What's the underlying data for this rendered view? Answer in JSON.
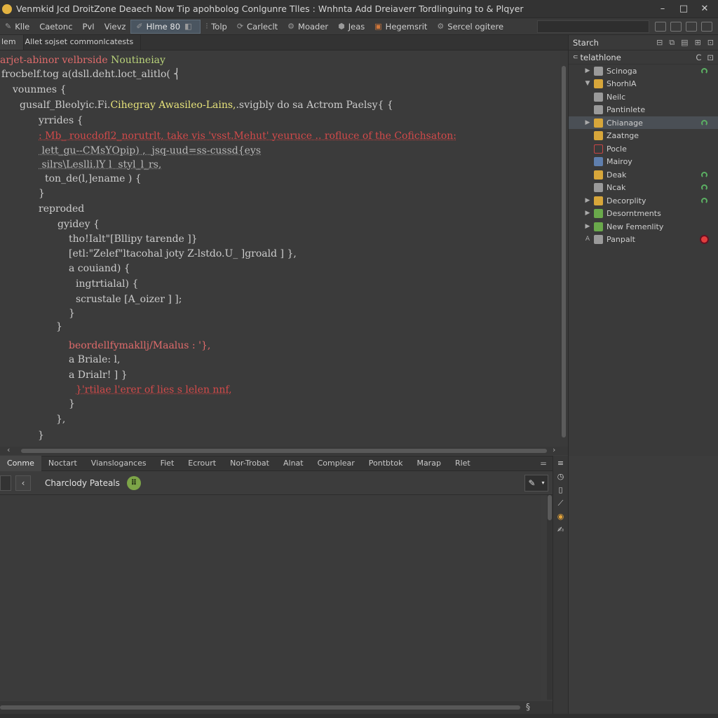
{
  "window": {
    "title": "Venmkid Jcd  DroitZone Deaech Now Tip apohbolog Conlgunre Tlles : Wnhnta Add Dreiaverr Tordlinguing to & Plqyer",
    "minimize": "–",
    "maximize": "□",
    "close": "✕"
  },
  "toolbar": {
    "items": [
      {
        "label": "Klle"
      },
      {
        "label": "Caetonc"
      },
      {
        "label": "PvI"
      },
      {
        "label": "Vievz"
      },
      {
        "label": "Hlme 80"
      },
      {
        "label": "Tolp"
      },
      {
        "label": "Carleclt"
      },
      {
        "label": "Moader"
      },
      {
        "label": "Jeas"
      },
      {
        "label": "Hegemsrit"
      },
      {
        "label": "Sercel ogitere"
      }
    ]
  },
  "editor": {
    "tabs": [
      {
        "label": "lem"
      },
      {
        "label": "Allet sojset commonlcatests"
      }
    ],
    "lines": [
      {
        "segments": [
          {
            "t": "arjet-abinor velbrside ",
            "c": "c-red"
          },
          {
            "t": "Noutineiay",
            "c": "c-green"
          }
        ]
      },
      {
        "segments": [
          {
            "t": "frocbelf.tog a(dsll.deht.loct_alitlo( ⎨",
            "c": ""
          }
        ]
      },
      {
        "segments": [
          {
            "t": "vounmes {",
            "c": ""
          }
        ]
      },
      {
        "segments": [
          {
            "t": "gusalf_Bleolyic.Fi.",
            "c": ""
          },
          {
            "t": "Cihegray Awasileo-Lains,",
            "c": "c-yellow"
          },
          {
            "t": ".svigbly do sa Actrom Paelsy{ {",
            "c": ""
          }
        ]
      },
      {
        "segments": [
          {
            "t": "yrrides {",
            "c": ""
          }
        ]
      },
      {
        "segments": [
          {
            "t": ": Mb_ roucdofl2_norutrlt, take vis 'vsst.Mehut' yeuruce .. rofluce of the Cofichsaton:",
            "c": "c-redsq"
          }
        ]
      },
      {
        "segments": [
          {
            "t": " lett_gu--CMsYOpip) ,  jsq-uud=ss-cussd{eys",
            "c": "c-dim"
          }
        ]
      },
      {
        "segments": [
          {
            "t": " silrs\\Leslli.lY l  styl_l_rs,",
            "c": "c-dim"
          }
        ]
      },
      {
        "segments": [
          {
            "t": "ton_de(l,]ename ) {",
            "c": ""
          }
        ]
      },
      {
        "segments": [
          {
            "t": "}",
            "c": ""
          }
        ]
      },
      {
        "segments": [
          {
            "t": "reproded",
            "c": ""
          }
        ]
      },
      {
        "segments": [
          {
            "t": "gyidey {",
            "c": ""
          }
        ]
      },
      {
        "segments": [
          {
            "t": "tho!Ialt\"[Bllipy tarende ]}",
            "c": ""
          }
        ]
      },
      {
        "segments": [
          {
            "t": "[etl:\"Zelef\"ltacohal joty Z-lstdo.U_ ]groald ] },",
            "c": ""
          }
        ]
      },
      {
        "segments": [
          {
            "t": "a couiand) {",
            "c": ""
          }
        ]
      },
      {
        "segments": [
          {
            "t": "ingtrtialal) {",
            "c": ""
          }
        ]
      },
      {
        "segments": [
          {
            "t": "scrustale [A_oizer ] ];",
            "c": ""
          }
        ]
      },
      {
        "segments": [
          {
            "t": "}",
            "c": ""
          }
        ]
      },
      {
        "segments": [
          {
            "t": "}",
            "c": ""
          }
        ]
      },
      {
        "segments": [
          {
            "t": "beordellfymakllj/Maalus : '},",
            "c": "c-red"
          }
        ]
      },
      {
        "segments": [
          {
            "t": "a Briale: l,",
            "c": ""
          }
        ]
      },
      {
        "segments": [
          {
            "t": "a Drialr! ] }",
            "c": ""
          }
        ]
      },
      {
        "segments": [
          {
            "t": "}'rtilae l'erer of lies s lelen nnf,",
            "c": "c-redsq"
          }
        ]
      },
      {
        "segments": [
          {
            "t": "}",
            "c": ""
          }
        ]
      },
      {
        "segments": [
          {
            "t": "},",
            "c": ""
          }
        ]
      },
      {
        "segments": [
          {
            "t": "}",
            "c": ""
          }
        ]
      }
    ]
  },
  "right_panel": {
    "header": "Starch",
    "sub_header": "telathlone",
    "tree": [
      {
        "label": "Scinoga",
        "arrow": "▶",
        "icon": "icon-file",
        "status": "st-green"
      },
      {
        "label": "ShorhlA",
        "arrow": "▼",
        "icon": "icon-folder",
        "status": ""
      },
      {
        "label": "Neilc",
        "arrow": "",
        "icon": "icon-file",
        "status": ""
      },
      {
        "label": "Pantinlete",
        "arrow": "",
        "icon": "icon-file",
        "status": ""
      },
      {
        "label": "Chianage",
        "arrow": "▶",
        "icon": "icon-folder",
        "status": "st-green",
        "selected": true
      },
      {
        "label": "Zaatnge",
        "arrow": "",
        "icon": "icon-folder",
        "status": ""
      },
      {
        "label": "Pocle",
        "arrow": "",
        "icon": "icon-red",
        "status": ""
      },
      {
        "label": "Mairoy",
        "arrow": "",
        "icon": "icon-blue",
        "status": ""
      },
      {
        "label": "Deak",
        "arrow": "",
        "icon": "icon-folder",
        "status": "st-green"
      },
      {
        "label": "Ncak",
        "arrow": "",
        "icon": "icon-file",
        "status": "st-green"
      },
      {
        "label": "Decorplity",
        "arrow": "▶",
        "icon": "icon-folder",
        "status": "st-green"
      },
      {
        "label": "Desorntments",
        "arrow": "▶",
        "icon": "icon-green",
        "status": ""
      },
      {
        "label": "New Femenlity",
        "arrow": "▶",
        "icon": "icon-green",
        "status": ""
      },
      {
        "label": "Panpalt",
        "arrow": "A",
        "icon": "icon-file",
        "status": "st-red"
      }
    ]
  },
  "bottom_panel": {
    "tabs": [
      {
        "label": "Conme",
        "active": true
      },
      {
        "label": "Noctart"
      },
      {
        "label": "Vianslogances"
      },
      {
        "label": "Fiet"
      },
      {
        "label": "Ecrourt"
      },
      {
        "label": "Nor-Trobat"
      },
      {
        "label": "Alnat"
      },
      {
        "label": "Complear"
      },
      {
        "label": "Pontbtok"
      },
      {
        "label": "Marap"
      },
      {
        "label": "Rlet"
      }
    ],
    "title": "Charclody Pateals",
    "badge": "⠿"
  },
  "colors": {
    "accent_green": "#7da548",
    "keyword_red": "#e06b6b",
    "string_yellow": "#e6e27a",
    "status_red": "#e23d3d"
  }
}
